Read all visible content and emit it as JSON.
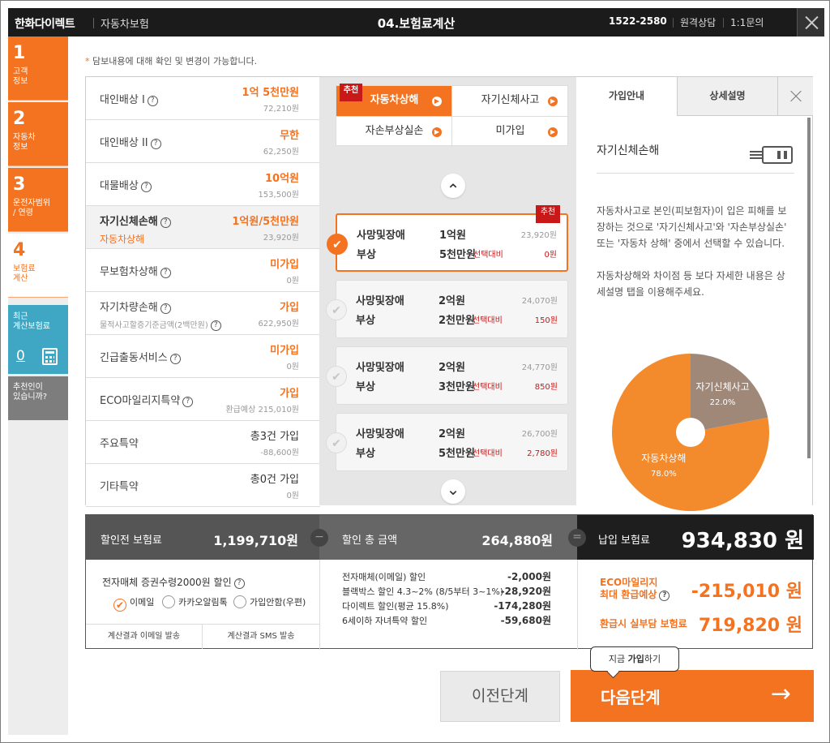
{
  "header": {
    "brand": "한화다이렉트",
    "service": "자동차보험",
    "title": "04.보험료계산",
    "phone": "1522-2580",
    "remote": "원격상담",
    "inquiry": "1:1문의"
  },
  "steps": [
    {
      "num": "1",
      "label": "고객\n정보"
    },
    {
      "num": "2",
      "label": "자동차\n정보"
    },
    {
      "num": "3",
      "label": "운전자범위\n/ 연령"
    },
    {
      "num": "4",
      "label": "보험료\n계산"
    }
  ],
  "recent": {
    "label": "최근\n계산보험료",
    "count": "0"
  },
  "recommend": {
    "label": "추천인이\n있습니까?"
  },
  "note": {
    "mark": "*",
    "text": "담보내용에 대해 확인 및 변경이 가능합니다."
  },
  "coverages": [
    {
      "name": "대인배상 I",
      "help": "?",
      "value": "1억 5천만원",
      "price": "72,210원",
      "sub": ""
    },
    {
      "name": "대인배상 II",
      "help": "?",
      "value": "무한",
      "price": "62,250원",
      "sub": ""
    },
    {
      "name": "대물배상",
      "help": "?",
      "value": "10억원",
      "price": "153,500원",
      "sub": ""
    },
    {
      "name": "자기신체손해",
      "help": "?",
      "value": "1억원/5천만원",
      "price": "23,920원",
      "sub": "자동차상해"
    },
    {
      "name": "무보험차상해",
      "help": "?",
      "value": "미가입",
      "price": "0원",
      "sub": ""
    },
    {
      "name": "자기차량손해",
      "help": "?",
      "value": "가입",
      "price": "622,950원",
      "sub": "물적사고할증기준금액(2백만원)"
    },
    {
      "name": "긴급출동서비스",
      "help": "?",
      "value": "미가입",
      "price": "0원",
      "sub": ""
    },
    {
      "name": "ECO마일리지특약",
      "help": "?",
      "value": "가입",
      "price": "환급예상 215,010원",
      "sub": ""
    },
    {
      "name": "주요특약",
      "help": "",
      "value": "총3건 가입",
      "price": "-88,600원",
      "sub": ""
    },
    {
      "name": "기타특약",
      "help": "",
      "value": "총0건 가입",
      "price": "0원",
      "sub": ""
    }
  ],
  "options": {
    "tabs": [
      "자동차상해",
      "자기신체사고",
      "자손부상실손",
      "미가입"
    ],
    "badge": "추천",
    "up": "⌃",
    "down": "⌄",
    "cards": [
      {
        "l1": "사망및장애",
        "a1": "1억원",
        "p1": "23,920원",
        "l2": "부상",
        "a2": "5천만원",
        "sel": "선택대비",
        "d": "0원",
        "flag": "추천"
      },
      {
        "l1": "사망및장애",
        "a1": "2억원",
        "p1": "24,070원",
        "l2": "부상",
        "a2": "2천만원",
        "sel": "선택대비",
        "d": "150원"
      },
      {
        "l1": "사망및장애",
        "a1": "2억원",
        "p1": "24,770원",
        "l2": "부상",
        "a2": "3천만원",
        "sel": "선택대비",
        "d": "850원"
      },
      {
        "l1": "사망및장애",
        "a1": "2억원",
        "p1": "26,700원",
        "l2": "부상",
        "a2": "5천만원",
        "sel": "선택대비",
        "d": "2,780원"
      }
    ]
  },
  "info": {
    "tabs": [
      "가입안내",
      "상세설명"
    ],
    "heading": "자기신체손해",
    "para1": "자동차사고로 본인(피보험자)이 입은 피해를 보장하는 것으로 '자기신체사고'와 '자손부상실손' 또는 '자동차 상해' 중에서 선택할 수 있습니다.",
    "para2": "자동차상해와 차이점 등 보다 자세한 내용은 상세설명 탭을 이용해주세요."
  },
  "chart_data": {
    "type": "pie",
    "categories": [
      "자기신체사고",
      "자동차상해"
    ],
    "values": [
      22.0,
      78.0
    ],
    "labels": [
      "22.0%",
      "78.0%"
    ],
    "colors": [
      "#a08878",
      "#f38a2c"
    ]
  },
  "summary": {
    "before_label": "할인전 보험료",
    "before_value": "1,199,710원",
    "disc_label": "할인 총 금액",
    "disc_value": "264,880원",
    "pay_label": "납입 보험료",
    "pay_value": "934,830 원",
    "minus": "−",
    "equals": "=",
    "sec_title": "전자매체 증권수령2000원 할인",
    "radios": [
      "이메일",
      "카카오알림톡",
      "가입안함(우편)"
    ],
    "btn_email": "계산결과 이메일 발송",
    "btn_sms": "계산결과 SMS 발송",
    "discounts": [
      {
        "label": "전자매체(이메일) 할인",
        "value": "-2,000원"
      },
      {
        "label": "블랙박스 할인 4.3~2% (8/5부터 3~1%)",
        "value": "-28,920원"
      },
      {
        "label": "다이렉트 할인(평균 15.8%)",
        "value": "-174,280원"
      },
      {
        "label": "6세이하 자녀특약 할인",
        "value": "-59,680원"
      }
    ],
    "eco_label1": "ECO마일리지",
    "eco_label2": "최대 환급예상",
    "eco_value": "-215,010 원",
    "refund_label": "환급시 실부담 보험료",
    "refund_value": "719,820 원"
  },
  "buttons": {
    "prev": "이전단계",
    "next": "다음단계",
    "next_arrow": "→",
    "tip_pre": "지금 ",
    "tip_bold": "가입",
    "tip_post": "하기"
  }
}
